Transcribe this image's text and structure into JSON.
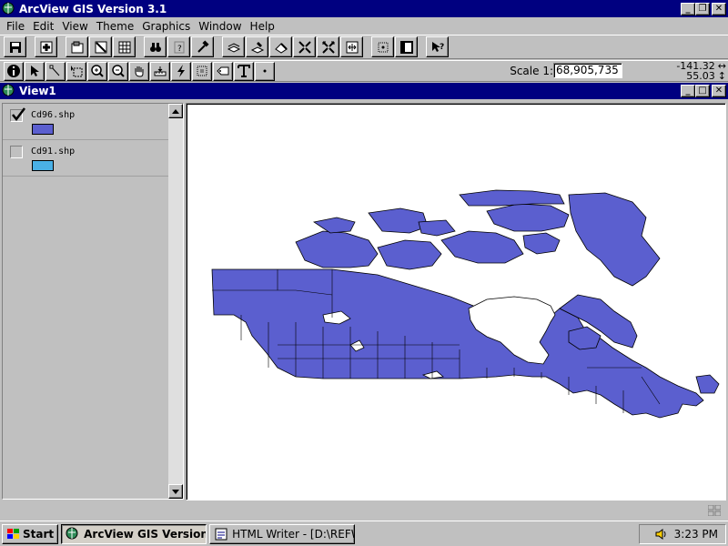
{
  "window": {
    "title": "ArcView GIS Version 3.1"
  },
  "menu": [
    "File",
    "Edit",
    "View",
    "Theme",
    "Graphics",
    "Window",
    "Help"
  ],
  "toolbar": {
    "scale_label": "Scale 1:",
    "scale_value": "68,905,735",
    "coord_x": "-141.32",
    "coord_y": "55.03"
  },
  "view": {
    "title": "View1",
    "themes": [
      {
        "name": "Cd96.shp",
        "checked": true,
        "color": "#5b5fcf"
      },
      {
        "name": "Cd91.shp",
        "checked": false,
        "color": "#4ab0e6"
      }
    ],
    "map_fill": "#5b5fcf"
  },
  "taskbar": {
    "start_label": "Start",
    "tasks": [
      "ArcView GIS Version ...",
      "HTML Writer - [D:\\REFW..."
    ],
    "clock": "3:23 PM"
  }
}
